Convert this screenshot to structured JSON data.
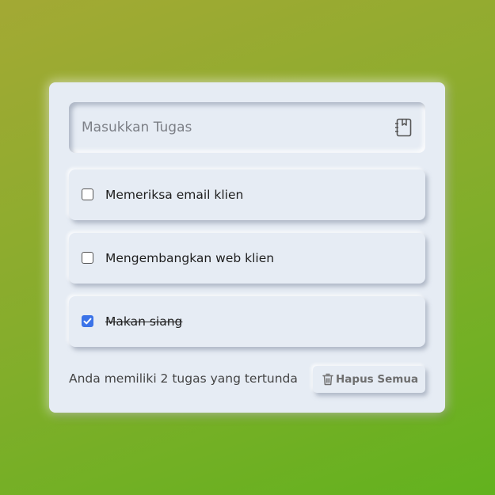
{
  "input": {
    "placeholder": "Masukkan Tugas",
    "icon": "notebook-icon"
  },
  "tasks": [
    {
      "label": "Memeriksa email klien",
      "checked": false
    },
    {
      "label": "Mengembangkan web klien",
      "checked": false
    },
    {
      "label": "Makan siang",
      "checked": true
    }
  ],
  "footer": {
    "status_text": "Anda memiliki 2 tugas yang tertunda",
    "clear_label": "Hapus Semua",
    "clear_icon": "trash-icon"
  },
  "colors": {
    "card_background": "#e6ecf4",
    "checkbox_accent": "#3b73e8",
    "gradient_top": "#a3a934",
    "gradient_bottom": "#62b21e"
  }
}
